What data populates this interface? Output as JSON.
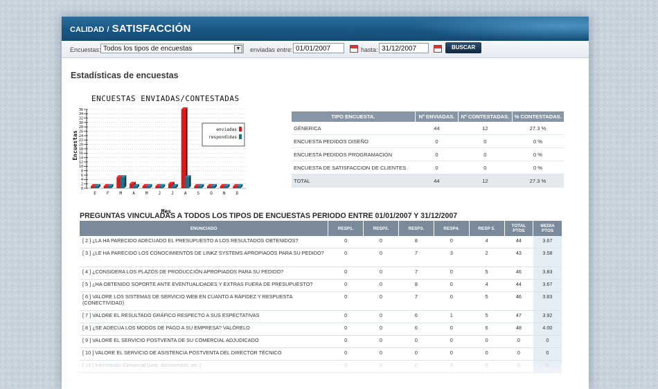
{
  "header": {
    "breadcrumb_parent": "CALIDAD",
    "breadcrumb_sep": "/",
    "title": "SATISFACCIÓN"
  },
  "filter": {
    "encuestas_label": "Encuestas:",
    "encuestas_value": "Todos los tipos de encuestas",
    "enviadas_label": "enviadas entre:",
    "from_date": "01/01/2007",
    "hasta_label": "hasta:",
    "to_date": "31/12/2007",
    "search_label": "BUSCAR"
  },
  "section_title": "Estadísticas de encuestas",
  "chart_data": {
    "type": "bar",
    "title": "ENCUESTAS ENVIADAS/CONTESTADAS",
    "xlabel": "Mes",
    "ylabel": "Encuestas",
    "categories": [
      "E",
      "F",
      "M",
      "A",
      "M",
      "J",
      "J",
      "A",
      "S",
      "O",
      "N",
      "D"
    ],
    "ytick_labels": [
      "0",
      "2",
      "4",
      "6",
      "8",
      "10",
      "12",
      "14",
      "16",
      "18",
      "20",
      "22",
      "24",
      "26",
      "28",
      "30",
      "32",
      "34",
      "36"
    ],
    "series": [
      {
        "name": "enviadas",
        "color": "#d81b1b",
        "values": [
          1,
          1,
          5,
          2,
          1,
          1,
          2,
          36,
          1,
          1,
          1,
          1
        ]
      },
      {
        "name": "respondidas",
        "color": "#1f6f8c",
        "values": [
          1,
          1,
          5,
          1,
          1,
          1,
          1,
          5,
          1,
          1,
          1,
          1
        ]
      }
    ],
    "ylim": [
      0,
      36
    ],
    "legend": "top-right",
    "grid": true
  },
  "survey_table": {
    "headers": [
      "TIPO ENCUESTA.",
      "Nº ENVIADAS.",
      "Nº CONTESTADAS.",
      "% CONTESTADAS."
    ],
    "rows": [
      [
        "GÉNERICA",
        "44",
        "12",
        "27.3 %"
      ],
      [
        "ENCUESTA PEDIDOS DISEÑO",
        "0",
        "0",
        "0 %"
      ],
      [
        "ENCUESTA PEDIDOS PROGRAMACIÓN",
        "0",
        "0",
        "0 %"
      ],
      [
        "ENCUESTA DE SATISFACCION DE CLIENTES",
        "0",
        "0",
        "0 %"
      ]
    ],
    "total": [
      "TOTAL",
      "44",
      "12",
      "27.3 %"
    ]
  },
  "questions_title": "PREGUNTAS VINCULADAS A TODOS LOS TIPOS DE ENCUESTAS PERIODO ENTRE 01/01/2007 Y 31/12/2007",
  "questions_table": {
    "headers": [
      "ENUNCIADO",
      "RESP1.",
      "RESP2.",
      "RESP3.",
      "RESP4.",
      "RESP 5.",
      "TOTAL PTOS",
      "MEDIA PTOS"
    ],
    "rows": [
      [
        "[ 2 ] ¿LA HA PARECIDO ADECUADO EL PRESUPUESTO A LOS RESULTADOS OBTENIDOS?",
        "0",
        "0",
        "8",
        "0",
        "4",
        "44",
        "3.67"
      ],
      [
        "[ 3 ] ¿LE HA PARECIDO LOS CONOCIMIENTOS DE LINKZ SYSTEMS APROPIADOS PARA SU PEDIDO?",
        "0",
        "0",
        "7",
        "3",
        "2",
        "43",
        "3.58"
      ],
      [
        "[ 4 ] ¿CONSIDERA LOS PLAZOS DE PRODUCCIÓN APROPIADOS PARA SU PEDIDO?",
        "0",
        "0",
        "7",
        "0",
        "5",
        "46",
        "3.83"
      ],
      [
        "[ 5 ] ¿HA OBTENIDO SOPORTE ANTE EVENTUALIDADES Y EXTRAS FUERA DE PRESUPUESTO?",
        "0",
        "0",
        "8",
        "0",
        "4",
        "44",
        "3.67"
      ],
      [
        "[ 6 ] VALORE LOS SISTEMAS DE SERVICIO WEB EN CUANTO A RÁPIDEZ Y RESPUESTA (CONECTIVIDAD)",
        "0",
        "0",
        "7",
        "0",
        "5",
        "46",
        "3.83"
      ],
      [
        "[ 7 ] VALORE EL RESULTADO GRÁFICO RESPECTO A SUS ESPECTATIVAS",
        "0",
        "0",
        "6",
        "1",
        "5",
        "47",
        "3.92"
      ],
      [
        "[ 8 ] ¿SE ADECUA LOS MODOS DE PAGO A SU EMPRESA? VALÓRELO",
        "0",
        "0",
        "6",
        "0",
        "6",
        "48",
        "4.00"
      ],
      [
        "[ 9 ] VALORE EL SERVICIO POSTVENTA DE SU COMERCIAL ADJUDICADO",
        "0",
        "0",
        "0",
        "0",
        "0",
        "0",
        "0"
      ],
      [
        "[ 10 ] VALORE EL SERVICIO DE ASISTENCIA POSTVENTA DEL DIRECTOR TÉCNICO",
        "0",
        "0",
        "0",
        "0",
        "0",
        "0",
        "0"
      ],
      [
        "[ 13 ] Información Comercial (web, documentos, etc.)",
        "0",
        "0",
        "0",
        "0",
        "0",
        "0",
        "0"
      ]
    ]
  }
}
